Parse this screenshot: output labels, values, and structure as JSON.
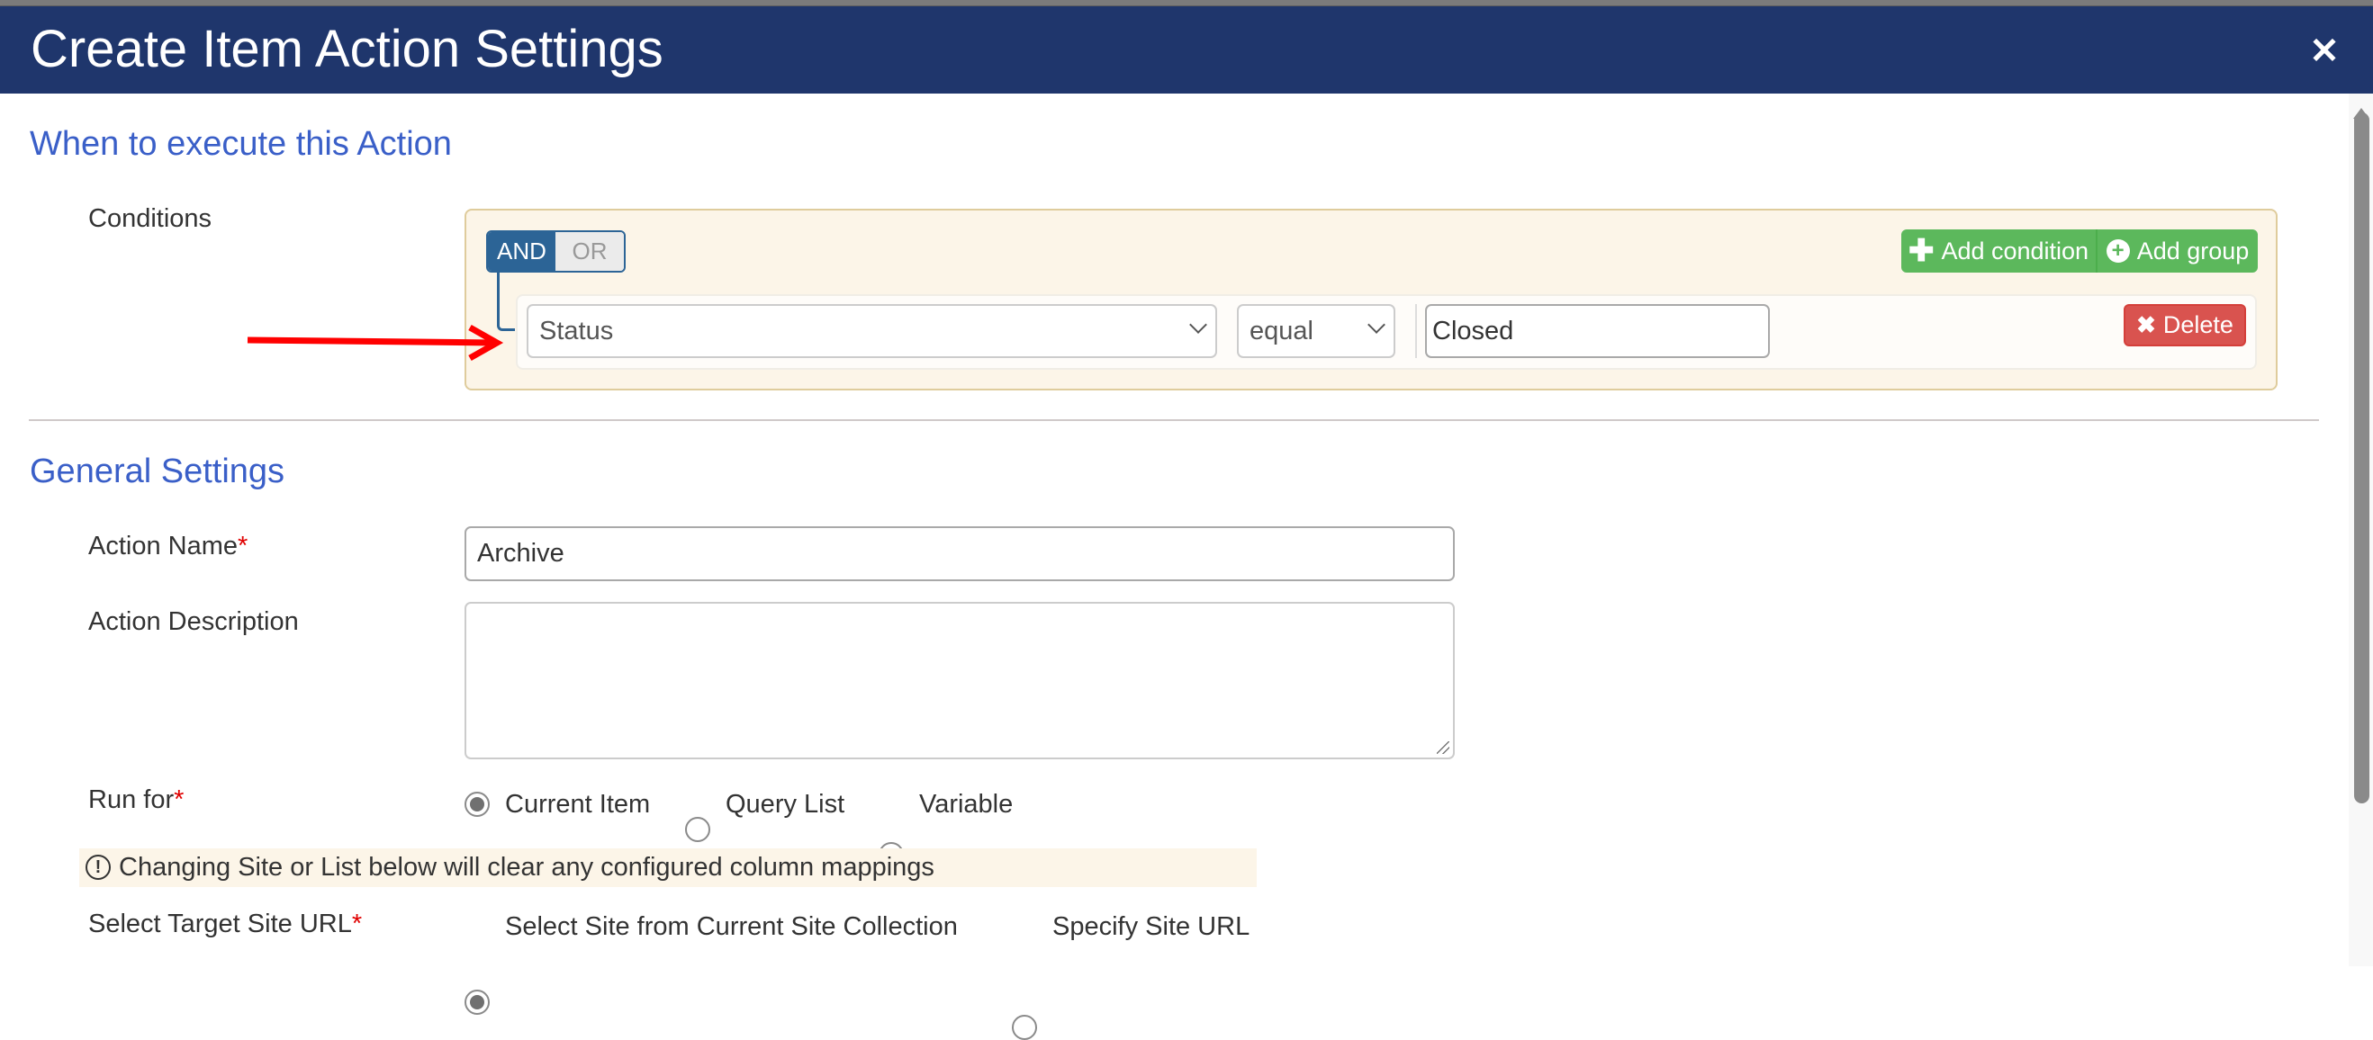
{
  "dialog": {
    "title": "Create Item Action Settings",
    "close_icon": "close-icon"
  },
  "when_section": {
    "heading": "When to execute this Action",
    "conditions_label": "Conditions",
    "logic_toggle": {
      "and_label": "AND",
      "or_label": "OR",
      "selected": "AND"
    },
    "add_condition_label": "Add condition",
    "add_group_label": "Add group",
    "rule": {
      "field": "Status",
      "operator": "equal",
      "value": "Closed",
      "delete_label": "Delete"
    }
  },
  "general_section": {
    "heading": "General Settings",
    "action_name": {
      "label": "Action Name",
      "required_mark": "*",
      "value": "Archive"
    },
    "action_description": {
      "label": "Action Description",
      "value": ""
    },
    "run_for": {
      "label": "Run for",
      "required_mark": "*",
      "options": [
        "Current Item",
        "Query List",
        "Variable"
      ],
      "selected": "Current Item"
    },
    "warning": "Changing Site or List below will clear any configured column mappings",
    "target_site": {
      "label": "Select Target Site URL",
      "required_mark": "*",
      "options": [
        "Select Site from Current Site Collection",
        "Specify Site URL"
      ],
      "selected": "Select Site from Current Site Collection"
    }
  },
  "colors": {
    "header_bg": "#1f366c",
    "section_heading": "#3a5fc8",
    "toggle_active": "#2c6496",
    "success": "#5cb85c",
    "danger": "#d9534f",
    "annotation_arrow": "#ff0000"
  }
}
